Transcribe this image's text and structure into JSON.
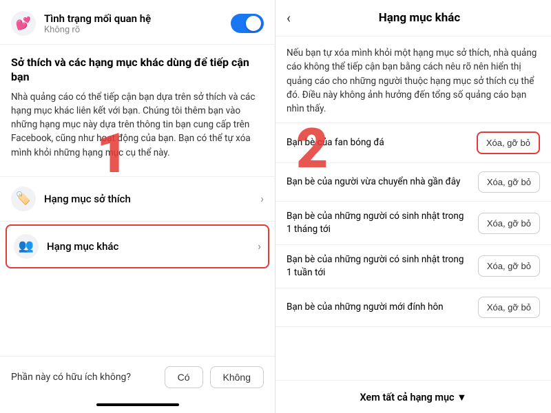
{
  "left": {
    "relationship_status": {
      "title": "Tình trạng mối quan hệ",
      "subtitle": "Không rõ"
    },
    "description_title": "Sở thích và các hạng mục khác dùng để tiếp cận bạn",
    "description_body": "Nhà quảng cáo có thể tiếp cận bạn dựa trên sở thích và các hạng mục khác liên kết với bạn. Chúng tôi thêm bạn vào những hạng mục này dựa trên thông tin bạn cung cấp trên Facebook, cũng như hoạt động của bạn. Bạn có thể tự xóa mình khỏi những hạng mục cụ thể này.",
    "menu_items": [
      {
        "label": "Hạng mục sở thích",
        "icon": "🏷️"
      },
      {
        "label": "Hạng mục khác",
        "icon": "👥"
      }
    ],
    "step_number": "1",
    "feedback": {
      "question": "Phần này có hữu ích không?",
      "yes": "Có",
      "no": "Không"
    }
  },
  "right": {
    "title": "Hạng mục khác",
    "description": "Nếu bạn tự xóa mình khỏi một hạng mục sở thích, nhà quảng cáo không thể tiếp cận bạn bằng cách nêu rõ nên hiển thị quảng cáo cho những người thuộc hạng mục sở thích cụ thể đó. Điều này không ảnh hưởng đến tổng số quảng cáo bạn nhìn thấy.",
    "step_number": "2",
    "items": [
      {
        "text": "Bạn bè của fan bóng đá",
        "button": "Xóa, gỡ bỏ",
        "highlighted": true
      },
      {
        "text": "Bạn bè của người vừa chuyển nhà gần đây",
        "button": "Xóa, gỡ bỏ",
        "highlighted": false
      },
      {
        "text": "Bạn bè của những người có sinh nhật trong 1 tháng tới",
        "button": "Xóa, gỡ bỏ",
        "highlighted": false
      },
      {
        "text": "Bạn bè của những người có sinh nhật trong 1 tuần tới",
        "button": "Xóa, gỡ bỏ",
        "highlighted": false
      },
      {
        "text": "Bạn bè của những người mới đính hôn",
        "button": "Xóa, gỡ bỏ",
        "highlighted": false
      }
    ],
    "view_all": "Xem tất cả hạng mục ▼"
  }
}
